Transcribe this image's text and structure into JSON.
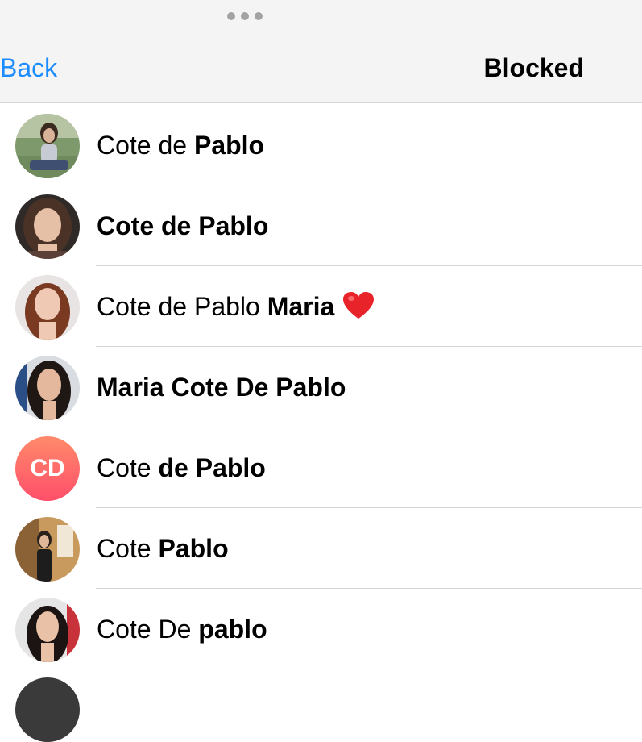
{
  "header": {
    "back_label": "Back",
    "title": "Blocked"
  },
  "contacts": [
    {
      "name_regular": "Cote de ",
      "name_bold": "Pablo",
      "avatar": "photo"
    },
    {
      "name_regular": "",
      "name_bold": "Cote de Pablo",
      "avatar": "photo"
    },
    {
      "name_regular": "Cote de Pablo ",
      "name_bold": "Maria",
      "avatar": "photo",
      "emoji": "heart-icon"
    },
    {
      "name_regular": "",
      "name_bold": "Maria Cote De Pablo",
      "avatar": "photo"
    },
    {
      "name_regular": "Cote ",
      "name_bold": "de Pablo",
      "avatar": "initials",
      "initials": "CD"
    },
    {
      "name_regular": "Cote ",
      "name_bold": "Pablo",
      "avatar": "photo"
    },
    {
      "name_regular": "Cote De ",
      "name_bold": "pablo",
      "avatar": "photo"
    }
  ],
  "colors": {
    "accent": "#1a8cff",
    "header_bg": "#f4f4f4",
    "separator": "#d4d4d4",
    "initials_gradient_top": "#ff8a6a",
    "initials_gradient_bottom": "#ff4f6a",
    "heart": "#e8232a"
  }
}
